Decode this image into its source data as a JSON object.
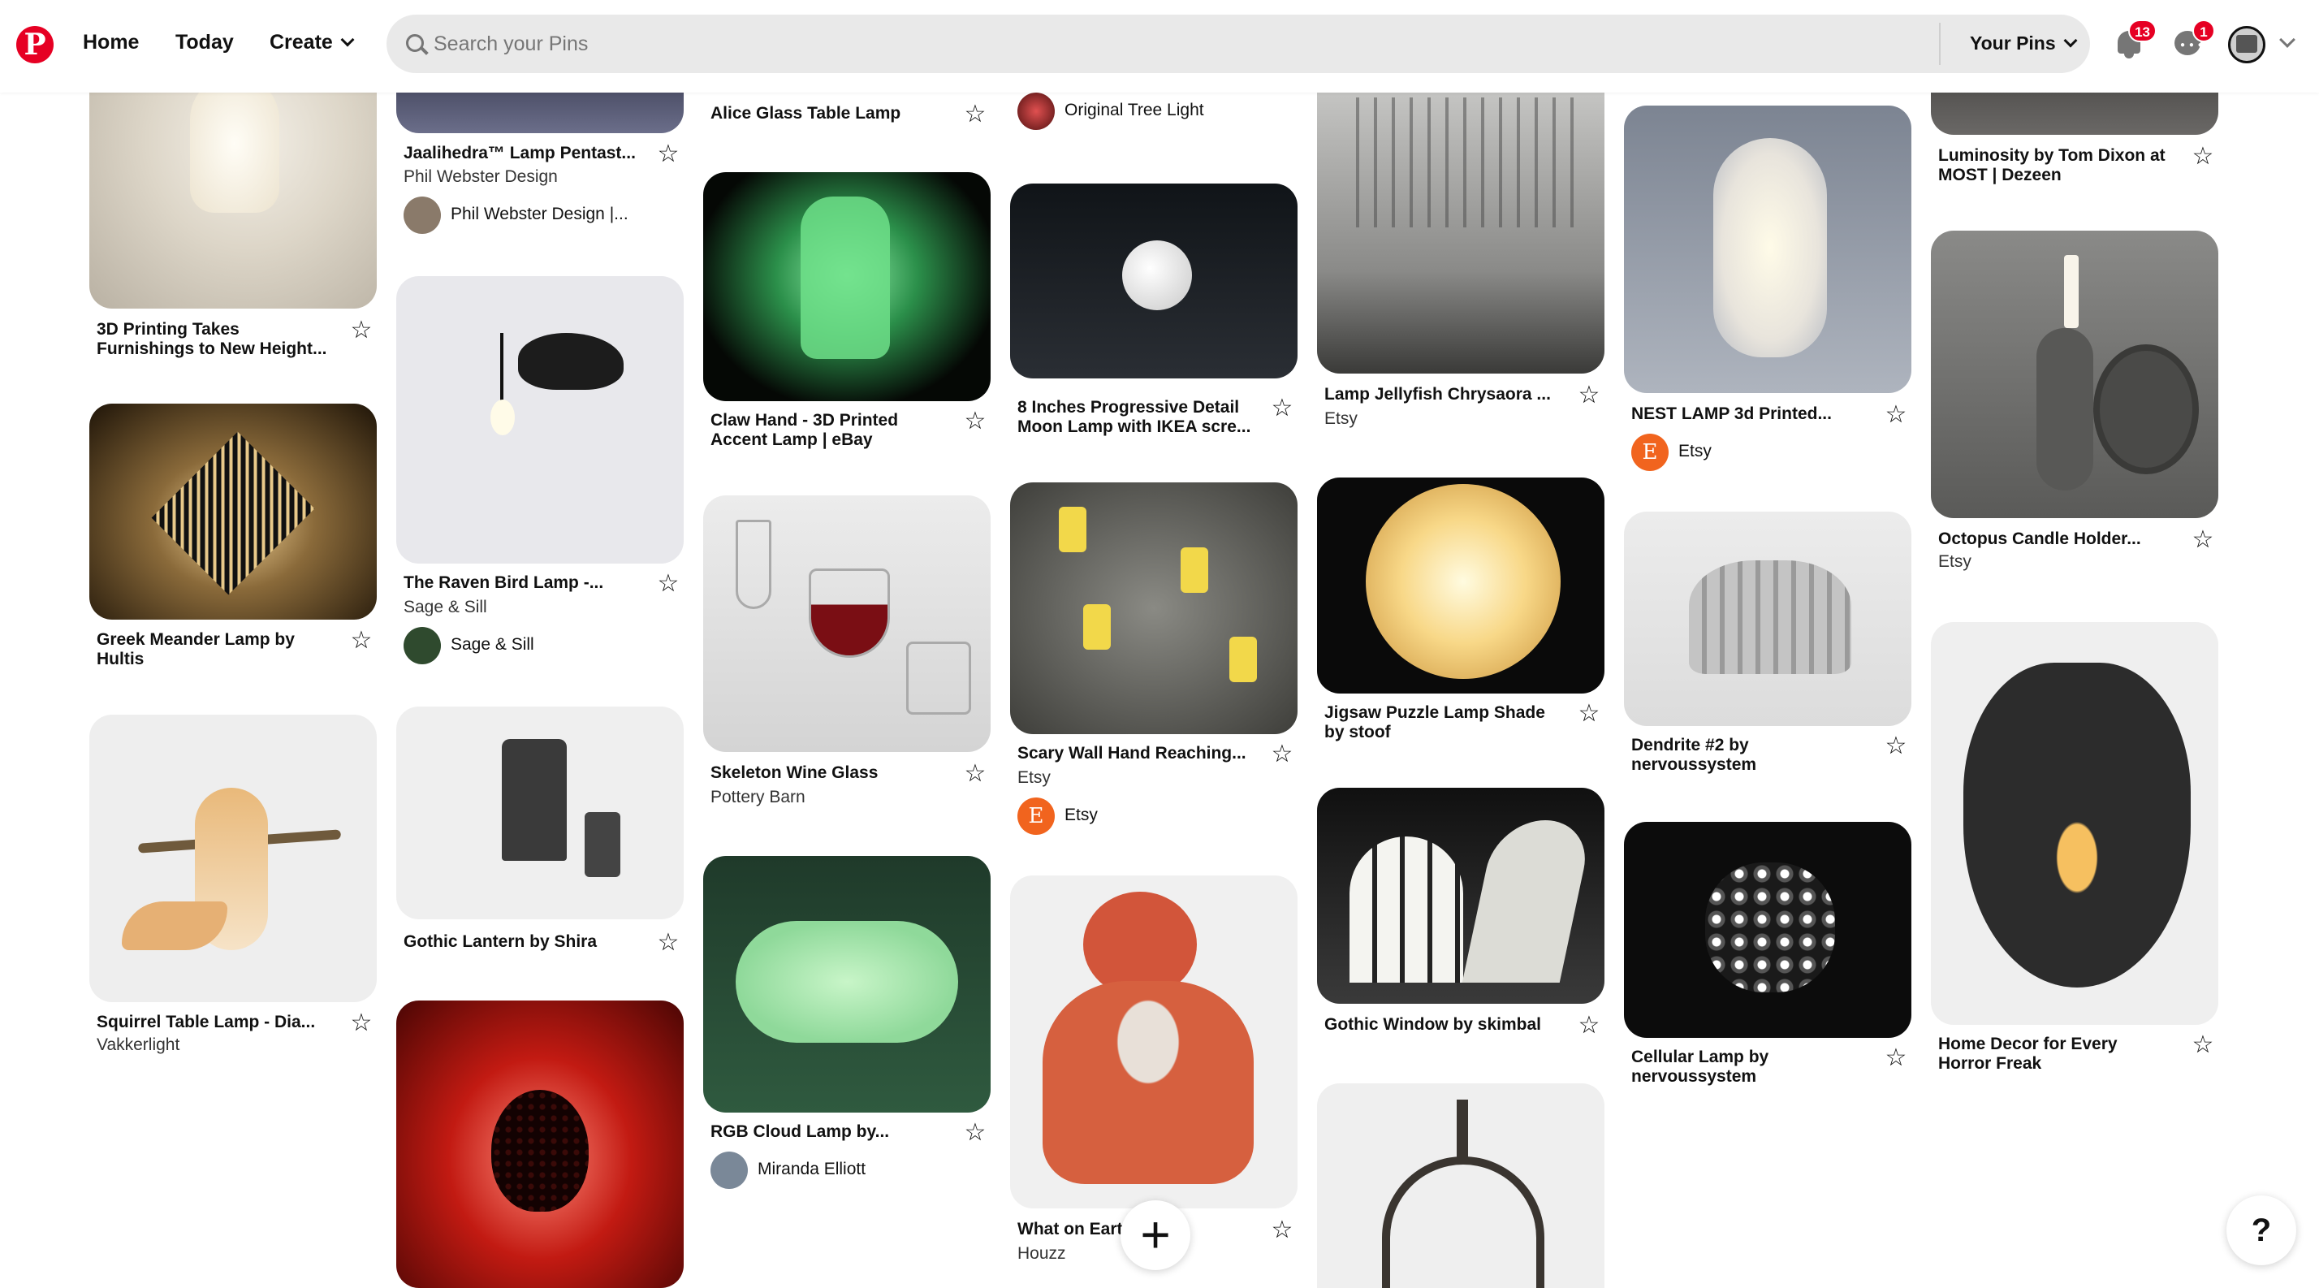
{
  "header": {
    "nav": {
      "home": "Home",
      "today": "Today",
      "create": "Create"
    },
    "search": {
      "placeholder": "Search your Pins",
      "value": ""
    },
    "your_pins": "Your Pins",
    "notifications_count": "13",
    "messages_count": "1",
    "logo_letter": "P",
    "brand_color": "#e60023"
  },
  "pins": [
    {
      "title": "3D Printing Takes Furnishings to New Height..."
    },
    {
      "title": "Greek Meander Lamp by Hultis"
    },
    {
      "title": "Squirrel Table Lamp - Dia...",
      "source": "Vakkerlight"
    },
    {
      "title": "Jaalihedra™ Lamp Pentast...",
      "source": "Phil Webster Design",
      "user": "Phil Webster Design |..."
    },
    {
      "title": "The Raven Bird Lamp -...",
      "source": "Sage & Sill",
      "user": "Sage & Sill"
    },
    {
      "title": "Gothic Lantern by Shira"
    },
    {
      "title": "Alice Glass Table Lamp"
    },
    {
      "title": "Claw Hand - 3D Printed Accent Lamp | eBay"
    },
    {
      "title": "Skeleton Wine Glass",
      "source": "Pottery Barn"
    },
    {
      "title": "RGB Cloud Lamp by...",
      "user": "Miranda Elliott"
    },
    {
      "user": "Original Tree Light"
    },
    {
      "title": "8 Inches Progressive Detail Moon Lamp with IKEA scre..."
    },
    {
      "title": "Scary Wall Hand Reaching...",
      "source": "Etsy",
      "user": "Etsy",
      "user_initial": "E"
    },
    {
      "title": "What on Eart   us...",
      "source": "Houzz"
    },
    {
      "title": "Lamp Jellyfish Chrysaora ...",
      "source": "Etsy"
    },
    {
      "title": "Jigsaw Puzzle Lamp Shade by stoof"
    },
    {
      "title": "Gothic Window by skimbal"
    },
    {
      "title": "NEST LAMP 3d Printed...",
      "user": "Etsy",
      "user_initial": "E"
    },
    {
      "title": "Dendrite #2 by nervoussystem"
    },
    {
      "title": "Cellular Lamp by nervoussystem"
    },
    {
      "title": "Luminosity by Tom Dixon at MOST | Dezeen"
    },
    {
      "title": "Octopus Candle Holder...",
      "source": "Etsy"
    },
    {
      "title": "Home Decor for Every Horror Freak"
    }
  ],
  "fab": {
    "add": "+",
    "help": "?"
  },
  "icons": {
    "save_pin": "star-outline-icon"
  }
}
